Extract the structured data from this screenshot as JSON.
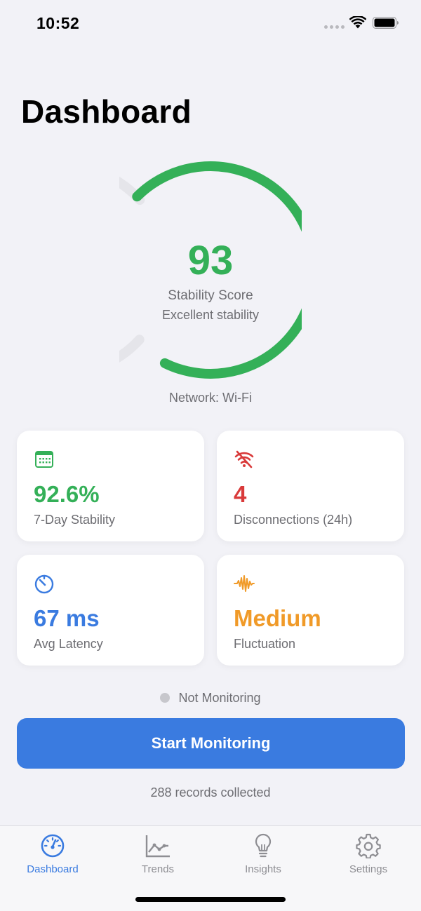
{
  "status_bar": {
    "time": "10:52",
    "icons": [
      "cellular-dots-icon",
      "wifi-icon",
      "battery-icon"
    ]
  },
  "page_title": "Dashboard",
  "score": {
    "value": "93",
    "label": "Stability Score",
    "subtitle": "Excellent stability",
    "fraction": 0.93,
    "color": "#34b058"
  },
  "network": "Network: Wi-Fi",
  "cards": [
    {
      "icon": "calendar-icon",
      "value": "92.6%",
      "label": "7-Day Stability",
      "color": "#34b058"
    },
    {
      "icon": "wifi-off-icon",
      "value": "4",
      "label": "Disconnections (24h)",
      "color": "#d93a3a"
    },
    {
      "icon": "timer-icon",
      "value": "67 ms",
      "label": "Avg Latency",
      "color": "#3a7be0"
    },
    {
      "icon": "waveform-icon",
      "value": "Medium",
      "label": "Fluctuation",
      "color": "#f09a28"
    }
  ],
  "monitoring": {
    "status": "Not Monitoring",
    "button": "Start Monitoring",
    "records": "288 records collected"
  },
  "tabs": [
    {
      "label": "Dashboard",
      "icon": "gauge-icon",
      "active": true
    },
    {
      "label": "Trends",
      "icon": "chart-line-icon",
      "active": false
    },
    {
      "label": "Insights",
      "icon": "lightbulb-icon",
      "active": false
    },
    {
      "label": "Settings",
      "icon": "gear-icon",
      "active": false
    }
  ],
  "colors": {
    "accent": "#3a7be0",
    "success": "#34b058",
    "danger": "#d93a3a",
    "warning": "#f09a28",
    "background": "#f2f2f7"
  }
}
